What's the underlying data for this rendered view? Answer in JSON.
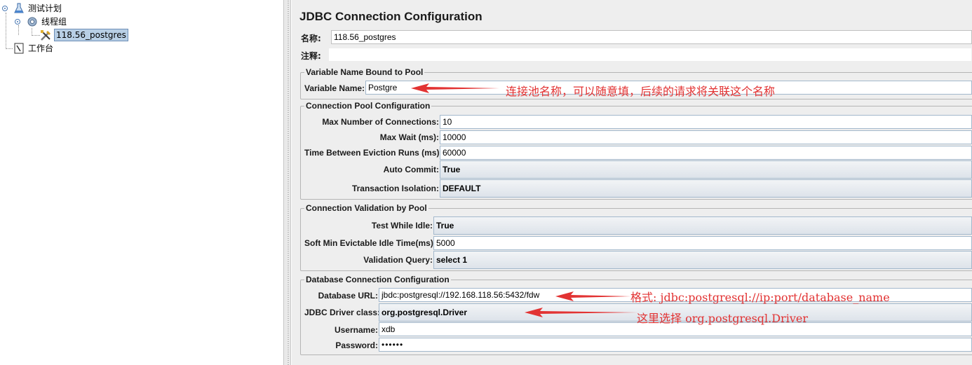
{
  "tree": {
    "root_label": "测试计划",
    "thread_group_label": "线程组",
    "jdbc_label": "118.56_postgres",
    "workbench_label": "工作台"
  },
  "panel": {
    "title": "JDBC Connection Configuration",
    "name_label": "名称:",
    "name_value": "118.56_postgres",
    "comment_label": "注释:",
    "comment_value": "",
    "variable_group": {
      "title": "Variable Name Bound to Pool",
      "variable_name_label": "Variable Name:",
      "variable_name_value": "Postgre"
    },
    "pool_group": {
      "title": "Connection Pool Configuration",
      "max_connections_label": "Max Number of Connections:",
      "max_connections_value": "10",
      "max_wait_label": "Max Wait (ms):",
      "max_wait_value": "10000",
      "eviction_label": "Time Between Eviction Runs (ms):",
      "eviction_value": "60000",
      "auto_commit_label": "Auto Commit:",
      "auto_commit_value": "True",
      "isolation_label": "Transaction Isolation:",
      "isolation_value": "DEFAULT"
    },
    "validation_group": {
      "title": "Connection Validation by Pool",
      "test_idle_label": "Test While Idle:",
      "test_idle_value": "True",
      "soft_min_label": "Soft Min Evictable Idle Time(ms):",
      "soft_min_value": "5000",
      "validation_query_label": "Validation Query:",
      "validation_query_value": "select 1"
    },
    "db_group": {
      "title": "Database Connection Configuration",
      "url_label": "Database URL:",
      "url_value": "jbdc:postgresql://192.168.118.56:5432/fdw",
      "driver_label": "JDBC Driver class:",
      "driver_value": "org.postgresql.Driver",
      "username_label": "Username:",
      "username_value": "xdb",
      "password_label": "Password:",
      "password_value": "••••••"
    }
  },
  "annotations": {
    "variable_note": "连接池名称，可以随意填，后续的请求将关联这个名称",
    "url_note": "格式: jdbc:postgresql://ip:port/database_name",
    "driver_note": "这里选择 org.postgresql.Driver",
    "color": "#e23333"
  },
  "colors": {
    "panel_bg": "#eeeeee",
    "selection_bg": "#b8cfe5",
    "field_border": "#a3b8cc"
  }
}
